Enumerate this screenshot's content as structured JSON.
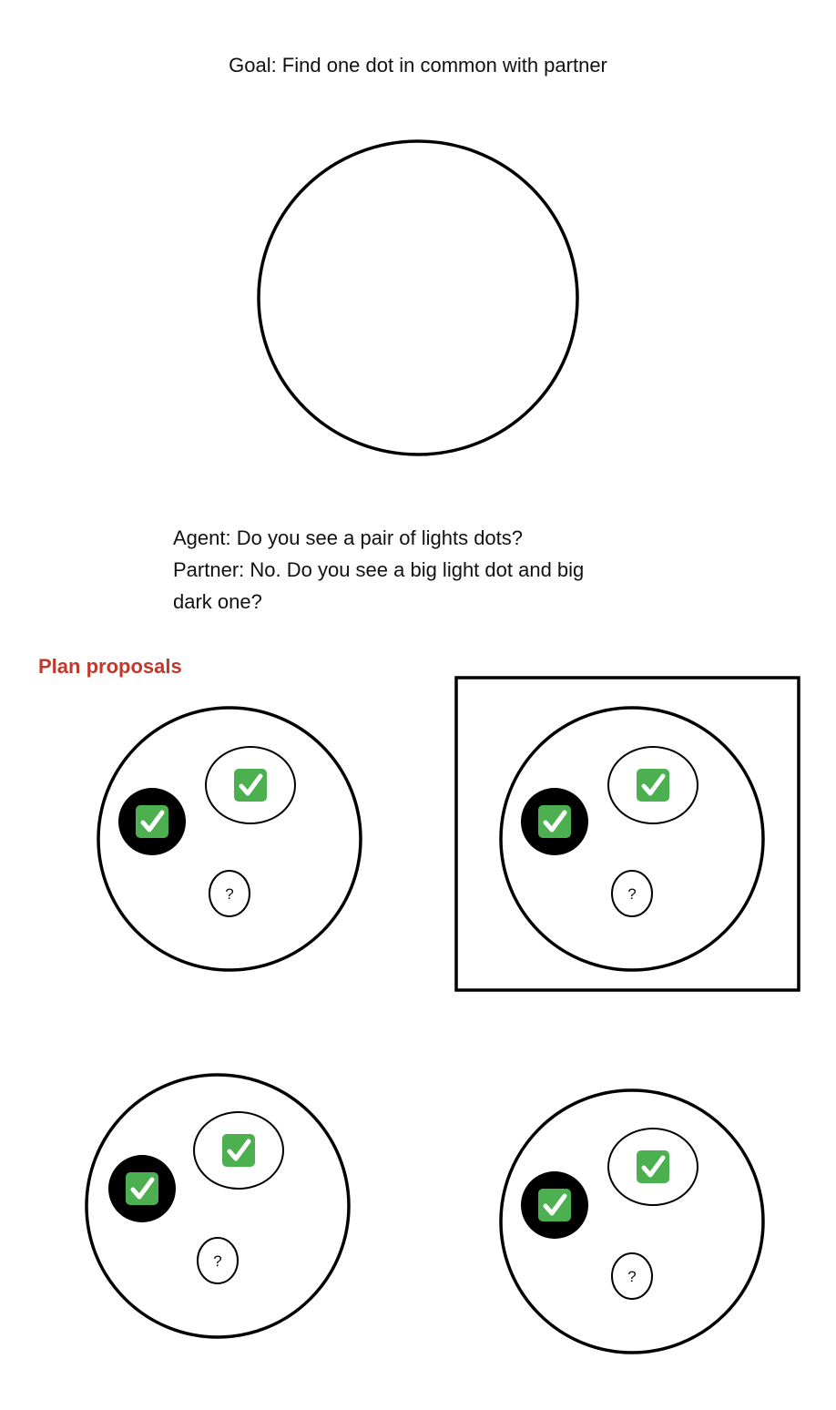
{
  "goal": "Goal: Find one dot in common with partner",
  "dialogue": [
    "Agent: Do you see a pair of lights dots?",
    "Partner: No. Do you see a big light dot and big",
    "dark one?"
  ],
  "section_title": "Plan proposals",
  "colors": {
    "accent": "#c0392b",
    "check_green": "#4caf50",
    "dark_dot": "#000000",
    "stroke": "#000000"
  },
  "proposals": [
    {
      "selected": false,
      "dots": [
        {
          "kind": "dark",
          "mark": "check"
        },
        {
          "kind": "light",
          "mark": "check"
        },
        {
          "kind": "light",
          "mark": "?"
        }
      ]
    },
    {
      "selected": true,
      "dots": [
        {
          "kind": "dark",
          "mark": "check"
        },
        {
          "kind": "light",
          "mark": "check"
        },
        {
          "kind": "light",
          "mark": "?"
        }
      ]
    },
    {
      "selected": false,
      "dots": [
        {
          "kind": "dark",
          "mark": "check"
        },
        {
          "kind": "light",
          "mark": "check"
        },
        {
          "kind": "light",
          "mark": "?"
        }
      ]
    },
    {
      "selected": false,
      "dots": [
        {
          "kind": "dark",
          "mark": "check"
        },
        {
          "kind": "light",
          "mark": "check"
        },
        {
          "kind": "light",
          "mark": "?"
        }
      ]
    }
  ]
}
